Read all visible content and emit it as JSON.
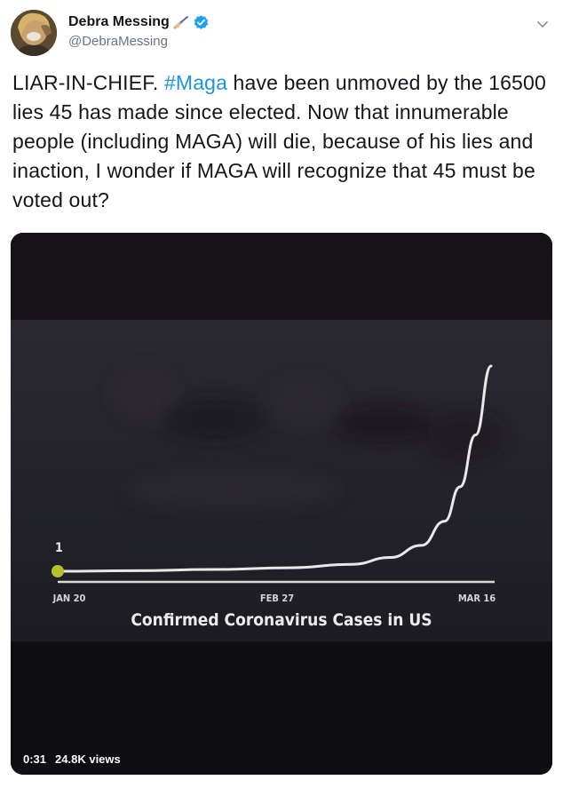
{
  "author": {
    "display_name": "Debra Messing",
    "handle": "@DebraMessing",
    "verified": true,
    "name_emoji": "writing-hand-icon"
  },
  "tweet": {
    "text_before_hashtag": "LIAR-IN-CHIEF. ",
    "hashtag": "#Maga",
    "text_after_hashtag": " have been unmoved by the 16500 lies 45 has made since elected. Now that innumerable people (including MAGA) will die, because of his lies and inaction, I wonder if MAGA will recognize that 45 must be voted out?"
  },
  "colors": {
    "hashtag": "#1b95e0",
    "verified_badge": "#1da1f2",
    "chart_dot": "#b5c22e",
    "chart_line": "#e8e8e8"
  },
  "video": {
    "time": "0:31",
    "views": "24.8K views"
  },
  "chart_data": {
    "type": "line",
    "title": "Confirmed Coronavirus Cases in US",
    "x_tick_labels": [
      "JAN 20",
      "FEB 27",
      "MAR 16"
    ],
    "start_label": "1",
    "series": [
      {
        "x": [
          "JAN 20",
          "JAN 30",
          "FEB 9",
          "FEB 19",
          "FEB 27",
          "MAR 3",
          "MAR 7",
          "MAR 10",
          "MAR 12",
          "MAR 14",
          "MAR 16"
        ],
        "y": [
          1,
          1.3,
          2,
          3,
          5,
          9,
          16,
          30,
          50,
          80,
          120
        ]
      }
    ]
  }
}
